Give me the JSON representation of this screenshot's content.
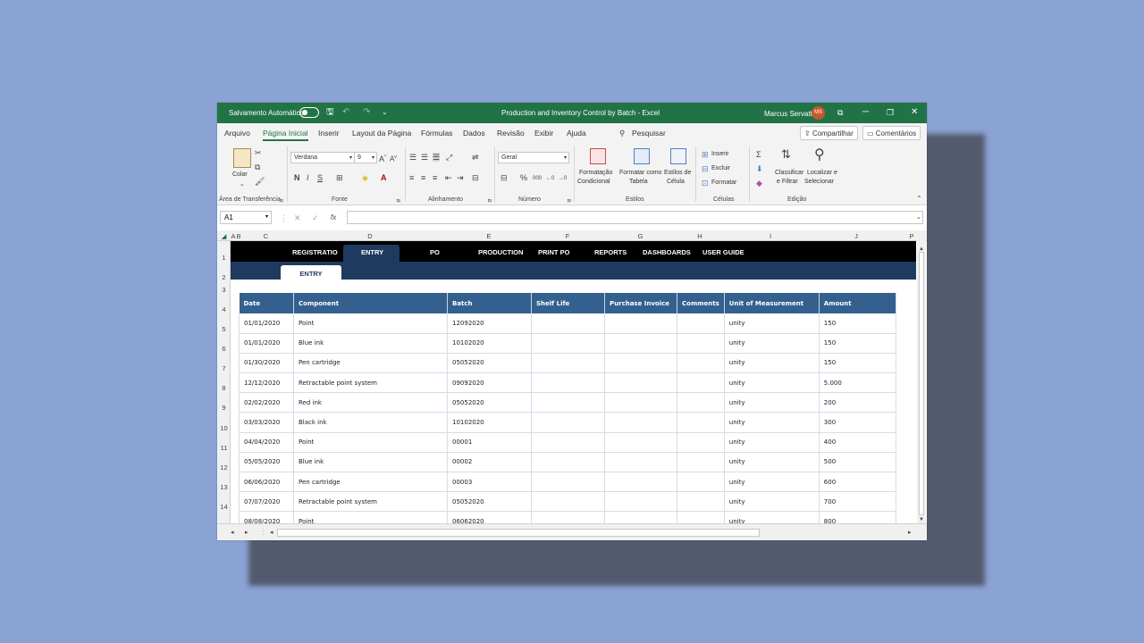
{
  "titlebar": {
    "autosave_label": "Salvamento Automático",
    "document_title": "Production and Inventory Control by Batch  -  Excel",
    "user_name": "Marcus Servatti",
    "user_initials": "MS"
  },
  "menu": {
    "tabs": [
      "Arquivo",
      "Página Inicial",
      "Inserir",
      "Layout da Página",
      "Fórmulas",
      "Dados",
      "Revisão",
      "Exibir",
      "Ajuda"
    ],
    "search_label": "Pesquisar",
    "share_label": "Compartilhar",
    "comments_label": "Comentários"
  },
  "ribbon": {
    "paste_label": "Colar",
    "font_name": "Verdana",
    "font_size": "9",
    "number_format": "Geral",
    "conditional_format_label_1": "Formatação",
    "conditional_format_label_2": "Condicional",
    "format_table_label_1": "Formatar como",
    "format_table_label_2": "Tabela",
    "cell_styles_label_1": "Estilos de",
    "cell_styles_label_2": "Célula",
    "insert_label": "Inserir",
    "delete_label": "Excluir",
    "format_label": "Formatar",
    "sort_filter_label_1": "Classificar",
    "sort_filter_label_2": "e Filtrar",
    "find_select_label_1": "Localizar e",
    "find_select_label_2": "Selecionar",
    "groups": {
      "clipboard": "Área de Transferência",
      "font": "Fonte",
      "alignment": "Alinhamento",
      "number": "Número",
      "styles": "Estilos",
      "cells": "Células",
      "editing": "Edição"
    }
  },
  "formula_bar": {
    "name_box": "A1",
    "fx_symbol": "fx",
    "value": ""
  },
  "grid": {
    "col_letters": [
      "A",
      "B",
      "C",
      "D",
      "E",
      "F",
      "G",
      "H",
      "I",
      "J",
      "P"
    ],
    "row_numbers": [
      "1",
      "2",
      "3",
      "4",
      "5",
      "6",
      "7",
      "8",
      "9",
      "10",
      "11",
      "12",
      "13",
      "14"
    ]
  },
  "sheet": {
    "nav": [
      "REGISTRATIO",
      "ENTRY",
      "PO",
      "PRODUCTION",
      "PRINT PO",
      "REPORTS",
      "DASHBOARDS",
      "USER GUIDE"
    ],
    "active_nav": "ENTRY",
    "subtab": "ENTRY",
    "table": {
      "headers": [
        "Date",
        "Component",
        "Batch",
        "Shelf Life",
        "Purchase Invoice",
        "Comments",
        "Unit of Measurement",
        "Amount"
      ],
      "rows": [
        [
          "01/01/2020",
          "Point",
          "12092020",
          "",
          "",
          "",
          "unity",
          "150"
        ],
        [
          "01/01/2020",
          "Blue ink",
          "10102020",
          "",
          "",
          "",
          "unity",
          "150"
        ],
        [
          "01/30/2020",
          "Pen cartridge",
          "05052020",
          "",
          "",
          "",
          "unity",
          "150"
        ],
        [
          "12/12/2020",
          "Retractable point system",
          "09092020",
          "",
          "",
          "",
          "unity",
          "5.000"
        ],
        [
          "02/02/2020",
          "Red ink",
          "05052020",
          "",
          "",
          "",
          "unity",
          "200"
        ],
        [
          "03/03/2020",
          "Black ink",
          "10102020",
          "",
          "",
          "",
          "unity",
          "300"
        ],
        [
          "04/04/2020",
          "Point",
          "00001",
          "",
          "",
          "",
          "unity",
          "400"
        ],
        [
          "05/05/2020",
          "Blue ink",
          "00002",
          "",
          "",
          "",
          "unity",
          "500"
        ],
        [
          "06/06/2020",
          "Pen cartridge",
          "00003",
          "",
          "",
          "",
          "unity",
          "600"
        ],
        [
          "07/07/2020",
          "Retractable point system",
          "05052020",
          "",
          "",
          "",
          "unity",
          "700"
        ],
        [
          "08/08/2020",
          "Point",
          "06062020",
          "",
          "",
          "",
          "unity",
          "800"
        ]
      ]
    }
  },
  "colors": {
    "excel_green": "#217346",
    "nav_black": "#000000",
    "nav_blue": "#1e3a5f",
    "table_header": "#34608f",
    "background": "#8ba3d4"
  }
}
